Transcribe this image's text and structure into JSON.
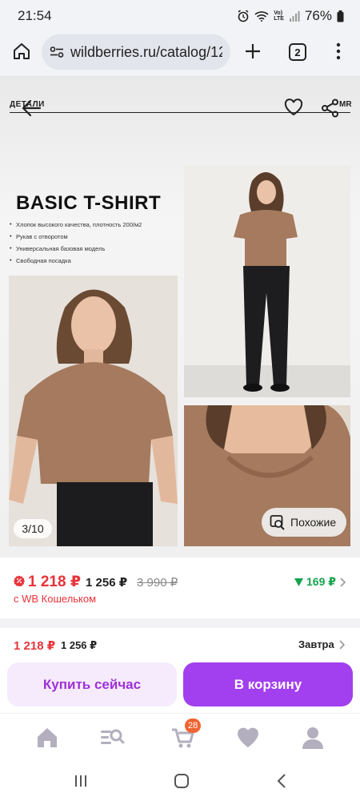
{
  "status_bar": {
    "time": "21:54",
    "battery": "76%",
    "net1": "Vo)",
    "net2": "LTE"
  },
  "browser": {
    "url": "wildberries.ru/catalog/12",
    "tab_count": "2"
  },
  "product_banner": {
    "brand_left": "ДЕТАЛИ",
    "brand_right": "MR",
    "title": "BASIC T-SHIRT",
    "bullets": [
      "Хлопок высокого качества, плотность 200/м2",
      "Рукав с отворотом",
      "Универсальная базовая модель",
      "Свободная посадка"
    ],
    "image_counter": "3/10",
    "similar_label": "Похожие"
  },
  "price": {
    "wallet_price": "1 218 ₽",
    "price": "1 256 ₽",
    "old_price": "3 990 ₽",
    "wallet_note": "с WB Кошельком",
    "cashback": "169 ₽"
  },
  "purchase": {
    "wallet_price": "1 218 ₽",
    "price": "1 256 ₽",
    "delivery": "Завтра",
    "buy_now": "Купить сейчас",
    "add_to_cart": "В корзину"
  },
  "bottom_nav": {
    "cart_badge": "28",
    "items": [
      "home-icon",
      "catalog-search-icon",
      "cart-icon",
      "favorites-icon",
      "profile-icon"
    ]
  },
  "colors": {
    "accent": "#a23fee",
    "price_red": "#e8333a",
    "cashback_green": "#14a44d",
    "cart_badge": "#f06431",
    "tee_brown": "#a57a5e"
  }
}
